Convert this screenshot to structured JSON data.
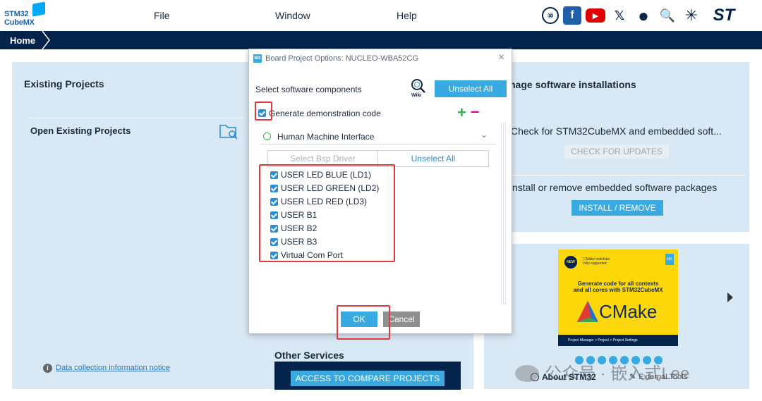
{
  "logo": {
    "line1": "STM32",
    "line2": "CubeMX"
  },
  "menu": {
    "file": "File",
    "window": "Window",
    "help": "Help"
  },
  "social": [
    {
      "icon": "anniversary-10-icon",
      "glyph": "⑩",
      "color": "#03234b"
    },
    {
      "icon": "facebook-icon",
      "glyph": "f",
      "color": "#1d5fa8"
    },
    {
      "icon": "youtube-icon",
      "glyph": "▶",
      "color": "#e00000"
    },
    {
      "icon": "x-icon",
      "glyph": "𝕏",
      "color": "#03234b"
    },
    {
      "icon": "github-icon",
      "glyph": "●",
      "color": "#03234b"
    },
    {
      "icon": "search-community-icon",
      "glyph": "🔍",
      "color": "#03234b"
    },
    {
      "icon": "network-icon",
      "glyph": "✳",
      "color": "#03234b"
    }
  ],
  "st_logo": "ST",
  "home": {
    "label": "Home"
  },
  "left_panel": {
    "title": "Existing Projects",
    "open_existing": "Open Existing Projects",
    "data_notice": "Data collection information notice"
  },
  "right_panel": {
    "title_fragment": "nage software installations",
    "check_text": "Check for STM32CubeMX and embedded soft...",
    "check_button": "CHECK FOR UPDATES",
    "install_text": "nstall or remove embedded software packages",
    "install_button": "INSTALL / REMOVE"
  },
  "cmake_card": {
    "badge_lines": [
      "CMake toolchain",
      "fully supported"
    ],
    "new_badge": "NEW",
    "headline_1": "Generate code for all contexts",
    "headline_2": "and all cores with STM32CubeMX",
    "brand": "CMake",
    "footer": "Project Manager > Project > Project Settings"
  },
  "other_services": {
    "title": "Other Services",
    "compare_button": "ACCESS TO COMPARE PROJECTS"
  },
  "bottom_tabs": {
    "about": "About STM32",
    "tools": "External Tools"
  },
  "watermark": "公众号 · 嵌入式Lee",
  "dialog": {
    "badge": "MX",
    "title": "Board Project Options: NUCLEO-WBA52CG",
    "close_glyph": "×",
    "select_label": "Select software components",
    "wiki_label": "Wiki",
    "unselect_all_top": "Unselect All",
    "generate_label": "Generate demonstration code",
    "generate_checked": true,
    "plus_glyph": "+",
    "minus_glyph": "–",
    "hmi_label": "Human Machine Interface",
    "hmi_chevron": "⌄",
    "bsp_tab": "Select Bsp Driver",
    "unselect_tab": "Unselect All",
    "options": [
      {
        "label": "USER LED BLUE (LD1)",
        "checked": true
      },
      {
        "label": "USER LED GREEN (LD2)",
        "checked": true
      },
      {
        "label": "USER LED RED (LD3)",
        "checked": true
      },
      {
        "label": "USER B1",
        "checked": true
      },
      {
        "label": "USER B2",
        "checked": true
      },
      {
        "label": "USER B3",
        "checked": true
      },
      {
        "label": "Virtual Com Port",
        "checked": true
      }
    ],
    "ok_button": "OK",
    "cancel_button": "Cancel"
  }
}
